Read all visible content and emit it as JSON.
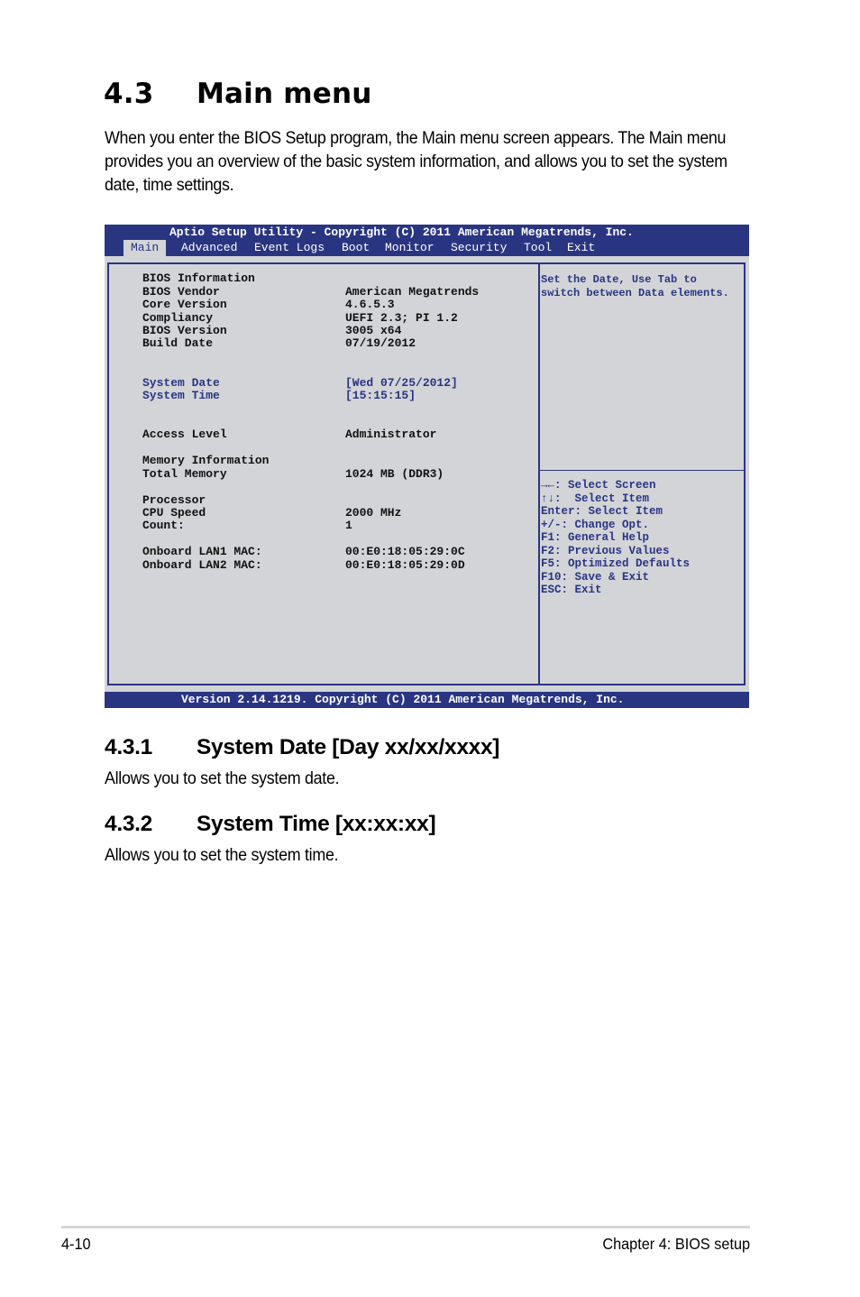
{
  "section": {
    "number": "4.3",
    "title": "Main menu",
    "intro": "When you enter the BIOS Setup program, the Main menu screen appears. The Main menu provides you an overview of the basic system information, and allows you to set the system date, time settings."
  },
  "bios": {
    "title": "Aptio Setup Utility - Copyright (C) 2011 American Megatrends, Inc.",
    "tabs": [
      {
        "label": "Main",
        "active": true
      },
      {
        "label": "Advanced"
      },
      {
        "label": "Event Logs"
      },
      {
        "label": "Boot"
      },
      {
        "label": "Monitor"
      },
      {
        "label": "Security"
      },
      {
        "label": "Tool"
      },
      {
        "label": "Exit"
      }
    ],
    "rows": [
      {
        "label": "BIOS Information",
        "value": ""
      },
      {
        "label": "BIOS Vendor",
        "value": "American Megatrends"
      },
      {
        "label": "Core Version",
        "value": "4.6.5.3"
      },
      {
        "label": "Compliancy",
        "value": "UEFI 2.3; PI 1.2"
      },
      {
        "label": "BIOS Version",
        "value": "3005 x64"
      },
      {
        "label": "Build Date",
        "value": "07/19/2012"
      },
      {
        "label": "System Date",
        "value": "[Wed 07/25/2012]"
      },
      {
        "label": "System Time",
        "value": "[15:15:15]"
      },
      {
        "label": "Access Level",
        "value": "Administrator"
      },
      {
        "label": "Memory Information",
        "value": ""
      },
      {
        "label": "Total Memory",
        "value": "1024 MB (DDR3)"
      },
      {
        "label": "Processor",
        "value": ""
      },
      {
        "label": "CPU Speed",
        "value": "2000 MHz"
      },
      {
        "label": "Count:",
        "value": "1"
      },
      {
        "label": "Onboard LAN1 MAC:",
        "value": "00:E0:18:05:29:0C"
      },
      {
        "label": "Onboard LAN2 MAC:",
        "value": "00:E0:18:05:29:0D"
      }
    ],
    "help_text": "Set the Date, Use Tab to\nswitch between Data elements.",
    "keys": [
      "→←: Select Screen",
      "↑↓:  Select Item",
      "Enter: Select Item",
      "+/-: Change Opt.",
      "F1: General Help",
      "F2: Previous Values",
      "F5: Optimized Defaults",
      "F10: Save & Exit",
      "ESC: Exit"
    ],
    "footer": "Version 2.14.1219. Copyright (C) 2011 American Megatrends, Inc.",
    "colors": {
      "bar": "#2a3582",
      "panel": "#d3d4d7"
    }
  },
  "subsections": [
    {
      "number": "4.3.1",
      "title": "System Date [Day xx/xx/xxxx]",
      "text": "Allows you to set the system date."
    },
    {
      "number": "4.3.2",
      "title": "System Time [xx:xx:xx]",
      "text": "Allows you to set the system time."
    }
  ],
  "footer": {
    "page": "4-10",
    "chapter": "Chapter 4: BIOS setup"
  }
}
